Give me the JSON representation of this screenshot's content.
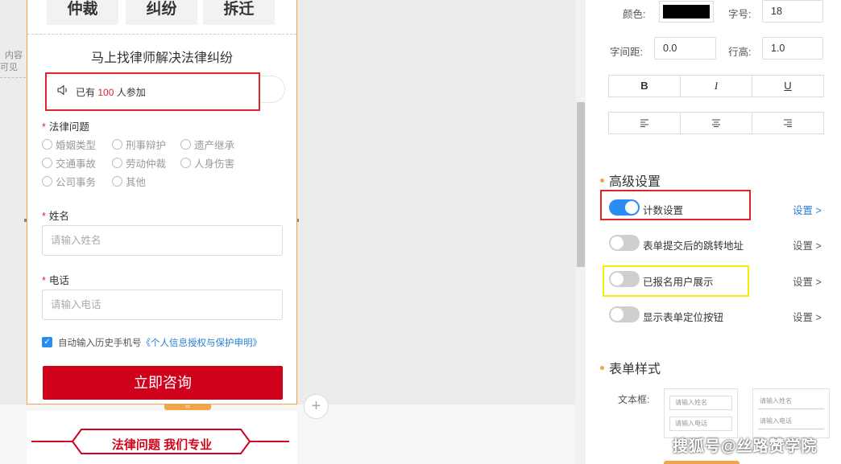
{
  "canvas": {
    "left_note_line1": "内容",
    "left_note_line2": "可见"
  },
  "form": {
    "categories": [
      "仲裁",
      "纠纷",
      "拆迁"
    ],
    "title": "马上找律师解决法律纠纷",
    "counter": {
      "prefix": "已有",
      "count": "100",
      "suffix": "人参加"
    },
    "legal_issue_label": "法律问题",
    "options": [
      "婚姻类型",
      "刑事辩护",
      "遗产继承",
      "交通事故",
      "劳动仲裁",
      "人身伤害",
      "公司事务",
      "其他"
    ],
    "name_label": "姓名",
    "name_placeholder": "请输入姓名",
    "phone_label": "电话",
    "phone_placeholder": "请输入电话",
    "auto_fill_text": "自动输入历史手机号",
    "privacy_link": "《个人信息授权与保护申明》",
    "submit_label": "立即咨询",
    "next_banner": "法律问题 我们专业"
  },
  "panel": {
    "color_label": "颜色:",
    "color_value": "#000000",
    "font_size_label": "字号:",
    "font_size_value": "18",
    "letter_spacing_label": "字间距:",
    "letter_spacing_value": "0.0",
    "line_height_label": "行高:",
    "line_height_value": "1.0",
    "format_buttons": [
      "B",
      "I",
      "U"
    ],
    "advanced_title": "高级设置",
    "settings": [
      {
        "label": "计数设置",
        "on": true,
        "link": "设置 >"
      },
      {
        "label": "表单提交后的跳转地址",
        "on": false,
        "link": "设置 >"
      },
      {
        "label": "已报名用户展示",
        "on": false,
        "link": "设置 >"
      },
      {
        "label": "显示表单定位按钮",
        "on": false,
        "link": "设置 >"
      }
    ],
    "style_title": "表单样式",
    "textbox_label": "文本框:",
    "style_card_1": [
      "请输入姓名",
      "请输入电话"
    ],
    "style_card_2": [
      "请输入姓名",
      "请输入电话"
    ]
  },
  "colors": {
    "accent_blue": "#2a8cf0",
    "submit_red": "#d0021b",
    "highlight_red": "#e4222c",
    "highlight_yellow": "#f5f000",
    "selection_orange": "#f0a54a",
    "link_blue": "#2a7fd4"
  },
  "watermark": "搜狐号@丝路赞学院"
}
